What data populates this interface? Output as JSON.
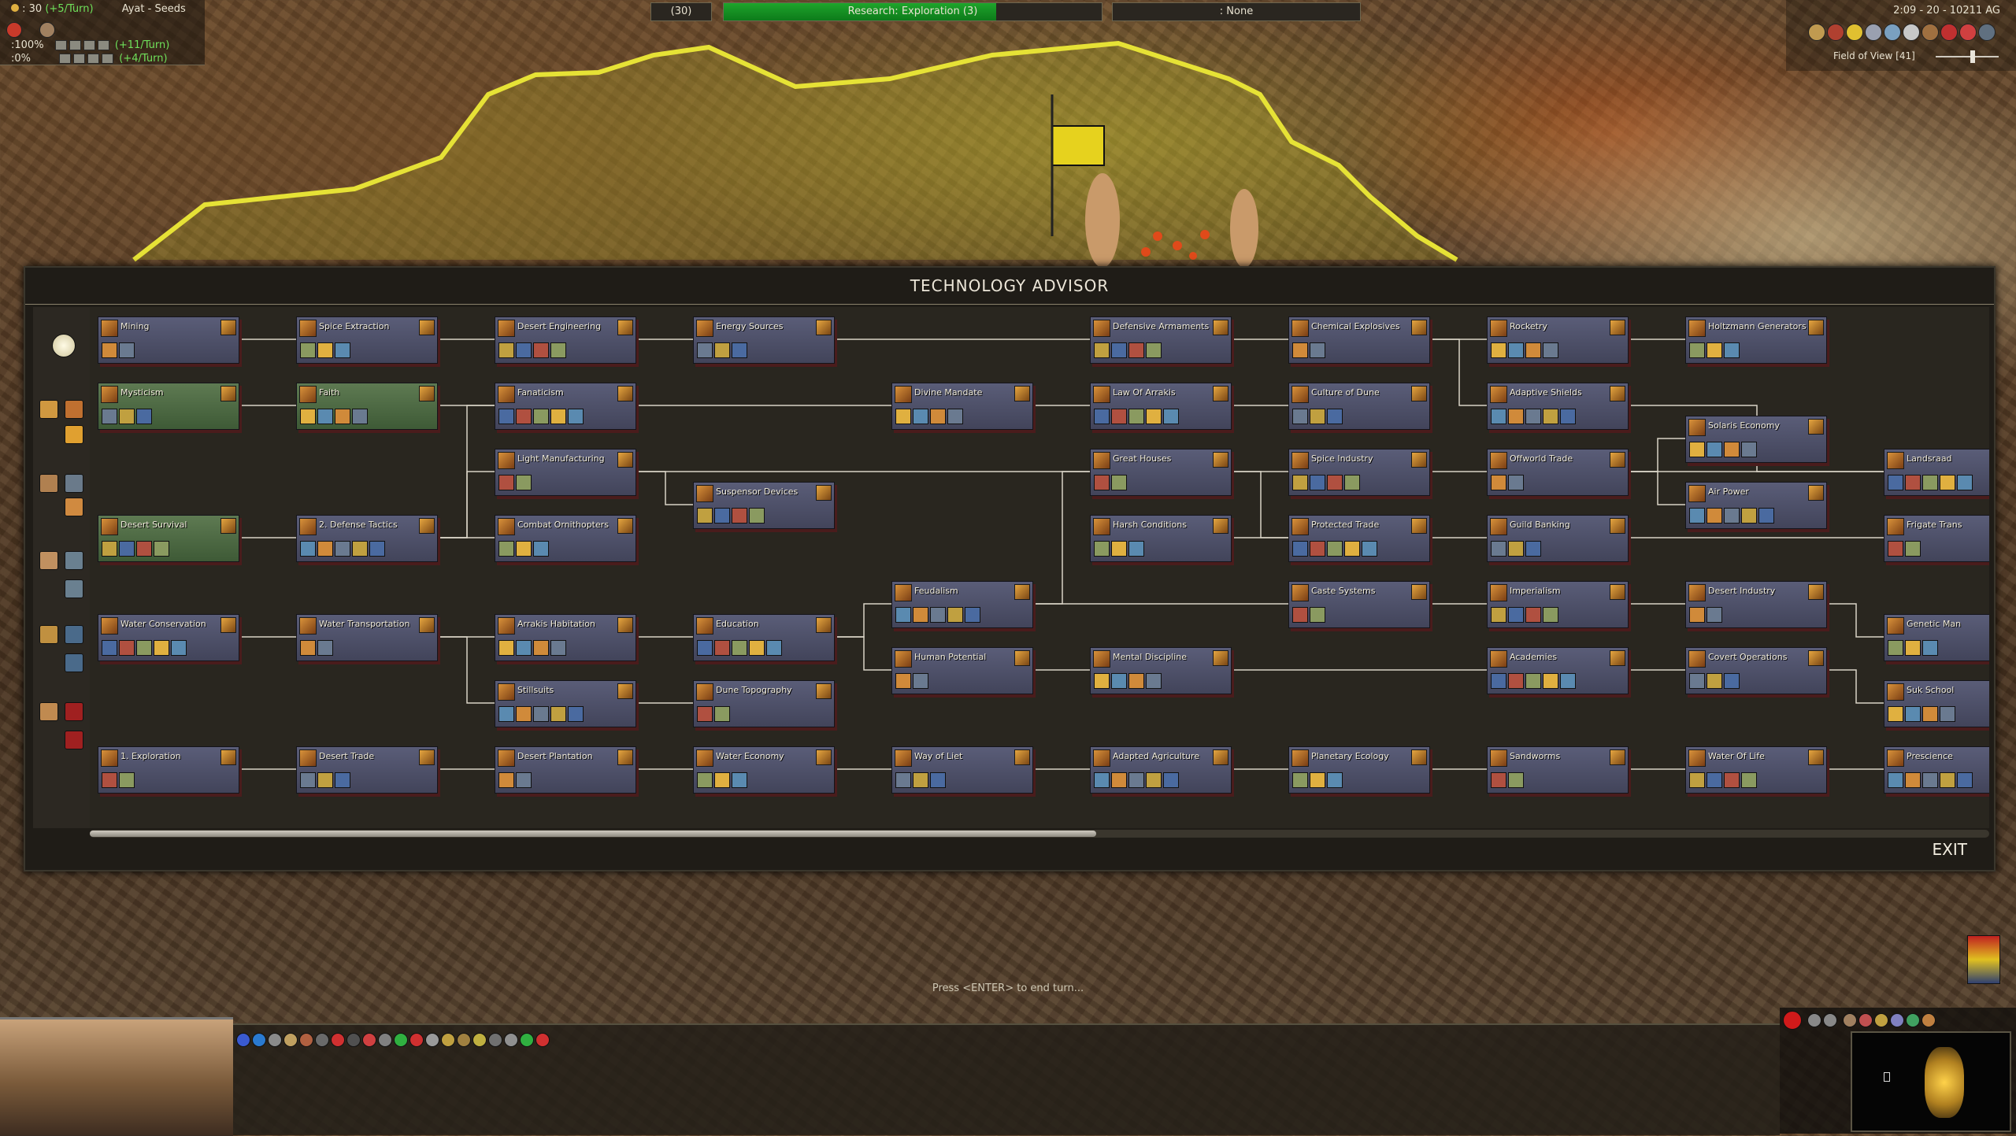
{
  "hud": {
    "left_line1": ": 30 ",
    "left_line1_rate": "(+5/Turn)",
    "player": "Ayat - Seeds",
    "left_line2": ":100%",
    "left_line2_rate": "(+11/Turn)",
    "left_line3": ":0%",
    "left_line3_rate": "(+4/Turn)",
    "research_count": "(30)",
    "research_label": "Research: Exploration (3)",
    "research_progress": 0.72,
    "none_label": ": None",
    "clock": "2:09 - 20 - 10211 AG",
    "field_of_view": "Field of View [41]",
    "press_enter": "Press <ENTER> to end turn..."
  },
  "advisor": {
    "title": "TECHNOLOGY ADVISOR",
    "exit": "EXIT",
    "techs": [
      {
        "id": "mining",
        "label": "Mining",
        "col": 0,
        "row": 0,
        "style": "blue"
      },
      {
        "id": "mysticism",
        "label": "Mysticism",
        "col": 0,
        "row": 1,
        "style": "green"
      },
      {
        "id": "desert_survival",
        "label": "Desert Survival",
        "col": 0,
        "row": 3,
        "style": "green"
      },
      {
        "id": "water_conservation",
        "label": "Water Conservation",
        "col": 0,
        "row": 4.5,
        "style": "blue"
      },
      {
        "id": "exploration",
        "label": "1. Exploration",
        "col": 0,
        "row": 6.5,
        "style": "blue"
      },
      {
        "id": "spice_extraction",
        "label": "Spice Extraction",
        "col": 1,
        "row": 0,
        "style": "blue"
      },
      {
        "id": "faith",
        "label": "Faith",
        "col": 1,
        "row": 1,
        "style": "green"
      },
      {
        "id": "defense_tactics",
        "label": "2. Defense Tactics",
        "col": 1,
        "row": 3,
        "style": "blue"
      },
      {
        "id": "water_transportation",
        "label": "Water Transportation",
        "col": 1,
        "row": 4.5,
        "style": "blue"
      },
      {
        "id": "desert_trade",
        "label": "Desert Trade",
        "col": 1,
        "row": 6.5,
        "style": "blue"
      },
      {
        "id": "desert_engineering",
        "label": "Desert Engineering",
        "col": 2,
        "row": 0,
        "style": "blue"
      },
      {
        "id": "fanaticism",
        "label": "Fanaticism",
        "col": 2,
        "row": 1,
        "style": "blue"
      },
      {
        "id": "light_manufacturing",
        "label": "Light Manufacturing",
        "col": 2,
        "row": 2,
        "style": "blue"
      },
      {
        "id": "combat_ornithopters",
        "label": "Combat Ornithopters",
        "col": 2,
        "row": 3,
        "style": "blue"
      },
      {
        "id": "arrakis_habitation",
        "label": "Arrakis Habitation",
        "col": 2,
        "row": 4.5,
        "style": "blue"
      },
      {
        "id": "stillsuits",
        "label": "Stillsuits",
        "col": 2,
        "row": 5.5,
        "style": "blue"
      },
      {
        "id": "desert_plantation",
        "label": "Desert Plantation",
        "col": 2,
        "row": 6.5,
        "style": "blue"
      },
      {
        "id": "energy_sources",
        "label": "Energy Sources",
        "col": 3,
        "row": 0,
        "style": "blue"
      },
      {
        "id": "suspensor_devices",
        "label": "Suspensor Devices",
        "col": 3,
        "row": 2.5,
        "style": "blue"
      },
      {
        "id": "education",
        "label": "Education",
        "col": 3,
        "row": 4.5,
        "style": "blue"
      },
      {
        "id": "dune_topography",
        "label": "Dune Topography",
        "col": 3,
        "row": 5.5,
        "style": "blue"
      },
      {
        "id": "water_economy",
        "label": "Water Economy",
        "col": 3,
        "row": 6.5,
        "style": "blue"
      },
      {
        "id": "divine_mandate",
        "label": "Divine Mandate",
        "col": 4,
        "row": 1,
        "style": "blue"
      },
      {
        "id": "feudalism",
        "label": "Feudalism",
        "col": 4,
        "row": 4,
        "style": "blue"
      },
      {
        "id": "human_potential",
        "label": "Human Potential",
        "col": 4,
        "row": 5,
        "style": "blue"
      },
      {
        "id": "way_of_liet",
        "label": "Way of Liet",
        "col": 4,
        "row": 6.5,
        "style": "blue"
      },
      {
        "id": "defensive_armaments",
        "label": "Defensive Armaments",
        "col": 5,
        "row": 0,
        "style": "blue"
      },
      {
        "id": "law_of_arrakis",
        "label": "Law Of Arrakis",
        "col": 5,
        "row": 1,
        "style": "blue"
      },
      {
        "id": "great_houses",
        "label": "Great Houses",
        "col": 5,
        "row": 2,
        "style": "blue"
      },
      {
        "id": "harsh_conditions",
        "label": "Harsh Conditions",
        "col": 5,
        "row": 3,
        "style": "blue"
      },
      {
        "id": "mental_discipline",
        "label": "Mental Discipline",
        "col": 5,
        "row": 5,
        "style": "blue"
      },
      {
        "id": "adapted_agriculture",
        "label": "Adapted Agriculture",
        "col": 5,
        "row": 6.5,
        "style": "blue"
      },
      {
        "id": "chemical_explosives",
        "label": "Chemical Explosives",
        "col": 6,
        "row": 0,
        "style": "blue"
      },
      {
        "id": "culture_of_dune",
        "label": "Culture of Dune",
        "col": 6,
        "row": 1,
        "style": "blue"
      },
      {
        "id": "spice_industry",
        "label": "Spice Industry",
        "col": 6,
        "row": 2,
        "style": "blue"
      },
      {
        "id": "protected_trade",
        "label": "Protected Trade",
        "col": 6,
        "row": 3,
        "style": "blue"
      },
      {
        "id": "caste_systems",
        "label": "Caste Systems",
        "col": 6,
        "row": 4,
        "style": "blue"
      },
      {
        "id": "planetary_ecology",
        "label": "Planetary Ecology",
        "col": 6,
        "row": 6.5,
        "style": "blue"
      },
      {
        "id": "rocketry",
        "label": "Rocketry",
        "col": 7,
        "row": 0,
        "style": "blue"
      },
      {
        "id": "adaptive_shields",
        "label": "Adaptive Shields",
        "col": 7,
        "row": 1,
        "style": "blue"
      },
      {
        "id": "offworld_trade",
        "label": "Offworld Trade",
        "col": 7,
        "row": 2,
        "style": "blue"
      },
      {
        "id": "guild_banking",
        "label": "Guild Banking",
        "col": 7,
        "row": 3,
        "style": "blue"
      },
      {
        "id": "imperialism",
        "label": "Imperialism",
        "col": 7,
        "row": 4,
        "style": "blue"
      },
      {
        "id": "academies",
        "label": "Academies",
        "col": 7,
        "row": 5,
        "style": "blue"
      },
      {
        "id": "sandworms",
        "label": "Sandworms",
        "col": 7,
        "row": 6.5,
        "style": "blue"
      },
      {
        "id": "holtzmann_generators",
        "label": "Holtzmann Generators",
        "col": 8,
        "row": 0,
        "style": "blue"
      },
      {
        "id": "solaris_economy",
        "label": "Solaris Economy",
        "col": 8,
        "row": 1.5,
        "style": "blue"
      },
      {
        "id": "air_power",
        "label": "Air Power",
        "col": 8,
        "row": 2.5,
        "style": "blue"
      },
      {
        "id": "desert_industry",
        "label": "Desert Industry",
        "col": 8,
        "row": 4,
        "style": "blue"
      },
      {
        "id": "covert_operations",
        "label": "Covert Operations",
        "col": 8,
        "row": 5,
        "style": "blue"
      },
      {
        "id": "water_of_life",
        "label": "Water Of Life",
        "col": 8,
        "row": 6.5,
        "style": "blue"
      },
      {
        "id": "landsraad",
        "label": "Landsraad",
        "col": 9,
        "row": 2,
        "style": "blue"
      },
      {
        "id": "frigate_transport",
        "label": "Frigate Trans",
        "col": 9,
        "row": 3,
        "style": "blue"
      },
      {
        "id": "genetic_manipulation",
        "label": "Genetic Man",
        "col": 9,
        "row": 4.5,
        "style": "blue"
      },
      {
        "id": "suk_school",
        "label": "Suk School",
        "col": 9,
        "row": 5.5,
        "style": "blue"
      },
      {
        "id": "prescience",
        "label": "Prescience",
        "col": 9,
        "row": 6.5,
        "style": "blue"
      }
    ],
    "links": [
      [
        "mining",
        "spice_extraction"
      ],
      [
        "spice_extraction",
        "desert_engineering"
      ],
      [
        "desert_engineering",
        "energy_sources"
      ],
      [
        "energy_sources",
        "defensive_armaments"
      ],
      [
        "defensive_armaments",
        "chemical_explosives"
      ],
      [
        "chemical_explosives",
        "rocketry"
      ],
      [
        "chemical_explosives",
        "adaptive_shields"
      ],
      [
        "rocketry",
        "holtzmann_generators"
      ],
      [
        "mysticism",
        "faith"
      ],
      [
        "faith",
        "fanaticism"
      ],
      [
        "fanaticism",
        "divine_mandate"
      ],
      [
        "divine_mandate",
        "law_of_arrakis"
      ],
      [
        "law_of_arrakis",
        "culture_of_dune"
      ],
      [
        "defense_tactics",
        "fanaticism"
      ],
      [
        "defense_tactics",
        "light_manufacturing"
      ],
      [
        "defense_tactics",
        "combat_ornithopters"
      ],
      [
        "light_manufacturing",
        "suspensor_devices"
      ],
      [
        "light_manufacturing",
        "great_houses"
      ],
      [
        "great_houses",
        "spice_industry"
      ],
      [
        "great_houses",
        "protected_trade"
      ],
      [
        "spice_industry",
        "offworld_trade"
      ],
      [
        "offworld_trade",
        "solaris_economy"
      ],
      [
        "offworld_trade",
        "air_power"
      ],
      [
        "offworld_trade",
        "landsraad"
      ],
      [
        "guild_banking",
        "frigate_transport"
      ],
      [
        "protected_trade",
        "guild_banking"
      ],
      [
        "harsh_conditions",
        "protected_trade"
      ],
      [
        "desert_survival",
        "defense_tactics"
      ],
      [
        "water_conservation",
        "water_transportation"
      ],
      [
        "water_transportation",
        "arrakis_habitation"
      ],
      [
        "water_transportation",
        "stillsuits"
      ],
      [
        "arrakis_habitation",
        "education"
      ],
      [
        "stillsuits",
        "dune_topography"
      ],
      [
        "education",
        "feudalism"
      ],
      [
        "education",
        "human_potential"
      ],
      [
        "feudalism",
        "great_houses"
      ],
      [
        "feudalism",
        "caste_systems"
      ],
      [
        "caste_systems",
        "imperialism"
      ],
      [
        "imperialism",
        "desert_industry"
      ],
      [
        "human_potential",
        "mental_discipline"
      ],
      [
        "mental_discipline",
        "academies"
      ],
      [
        "academies",
        "covert_operations"
      ],
      [
        "covert_operations",
        "suk_school"
      ],
      [
        "desert_industry",
        "genetic_manipulation"
      ],
      [
        "exploration",
        "desert_trade"
      ],
      [
        "desert_trade",
        "desert_plantation"
      ],
      [
        "desert_plantation",
        "water_economy"
      ],
      [
        "water_economy",
        "way_of_liet"
      ],
      [
        "way_of_liet",
        "adapted_agriculture"
      ],
      [
        "adapted_agriculture",
        "planetary_ecology"
      ],
      [
        "planetary_ecology",
        "sandworms"
      ],
      [
        "sandworms",
        "water_of_life"
      ],
      [
        "water_of_life",
        "prescience"
      ],
      [
        "adaptive_shields",
        "landsraad"
      ]
    ],
    "scroll_fraction": 0.53
  },
  "colors": {
    "node_blue": "#4e5168",
    "node_green": "#4e6a44",
    "shadow_red": "#4a1c1c",
    "research_green": "#1ea52b",
    "territory_yellow": "#d7d23a"
  }
}
